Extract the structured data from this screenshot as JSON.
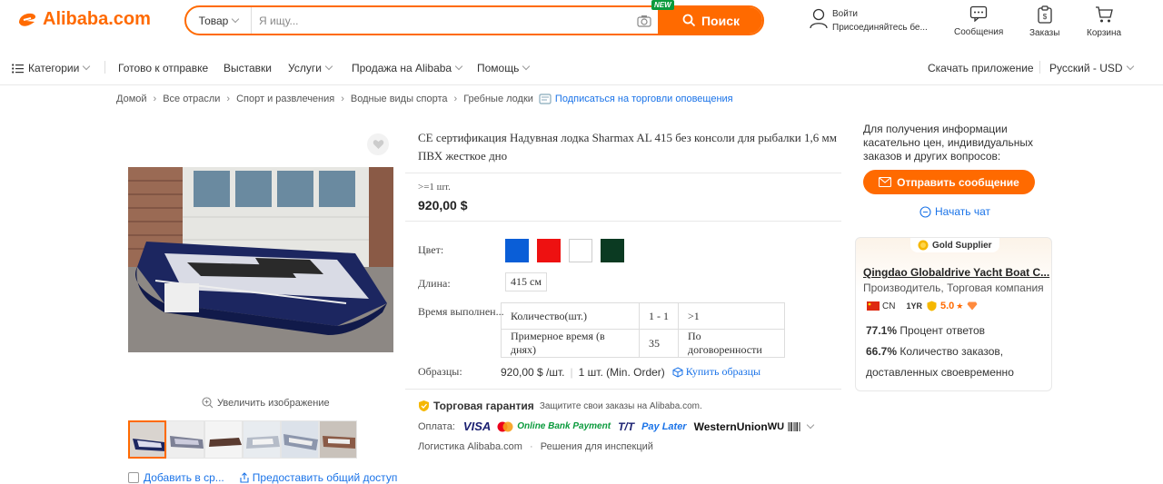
{
  "header": {
    "logo_text": "Alibaba.com",
    "search_category": "Товар",
    "search_placeholder": "Я ищу...",
    "new_badge": "NEW",
    "search_button": "Поиск",
    "signin_line1": "Войти",
    "signin_line2": "Присоединяйтесь бе...",
    "messages": "Сообщения",
    "orders": "Заказы",
    "cart": "Корзина"
  },
  "nav": {
    "categories": "Категории",
    "ready": "Готово к отправке",
    "exhibitions": "Выставки",
    "services": "Услуги",
    "sell": "Продажа на Alibaba",
    "help": "Помощь",
    "download_app": "Скачать приложение",
    "lang_currency": "Русский - USD"
  },
  "breadcrumb": {
    "items": [
      "Домой",
      "Все отрасли",
      "Спорт и развлечения",
      "Водные виды спорта",
      "Гребные лодки"
    ],
    "subscribe": "Подписаться на торговли оповещения"
  },
  "gallery": {
    "zoom_label": "Увеличить изображение",
    "add_compare": "Добавить в ср...",
    "share": "Предоставить общий доступ"
  },
  "product": {
    "title": "CE сертификация Надувная лодка Sharmax AL 415 без консоли для рыбалки 1,6 мм ПВХ жесткое дно",
    "moq": ">=1 шт.",
    "price": "920,00 $",
    "color_label": "Цвет:",
    "colors": [
      "#0a5ed7",
      "#ee1111",
      "#ffffff",
      "#0b3a22"
    ],
    "length_label": "Длина:",
    "length_value": "415 см",
    "lead_label": "Время выполнен...",
    "lead_table": {
      "row1": [
        "Количество(шт.)",
        "1 - 1",
        ">1"
      ],
      "row2": [
        "Примерное время (в днях)",
        "35",
        "По договоренности"
      ]
    },
    "samples_label": "Образцы:",
    "samples_price": "920,00 $ /шт.",
    "samples_min": "1 шт. (Min. Order)",
    "buy_samples": "Купить образцы",
    "guarantee_title": "Торговая гарантия",
    "guarantee_text": "Защитите свои заказы на Alibaba.com.",
    "payment_label": "Оплата:",
    "payment_methods": [
      "VISA",
      "Online Bank Payment",
      "T/T",
      "Pay Later",
      "WesternUnion",
      "WU"
    ],
    "logistics": "Логистика Alibaba.com",
    "inspection": "Решения для инспекций"
  },
  "sidebar": {
    "inquiry_text": "Для получения информации касательно цен, индивидуальных заказов и других вопросов:",
    "send_message": "Отправить сообщение",
    "start_chat": "Начать чат",
    "supplier": {
      "badge": "Gold Supplier",
      "name": "Qingdao Globaldrive Yacht Boat C...",
      "type": "Производитель, Торговая компания",
      "country": "CN",
      "years": "1YR",
      "rating": "5.0",
      "response_rate": "77.1%",
      "response_label": "Процент ответов",
      "ontime_rate": "66.7%",
      "ontime_label1": "Количество заказов,",
      "ontime_label2": "доставленных своевременно"
    }
  },
  "colors": {
    "accent": "#ff6a00",
    "link": "#1a73e8"
  }
}
